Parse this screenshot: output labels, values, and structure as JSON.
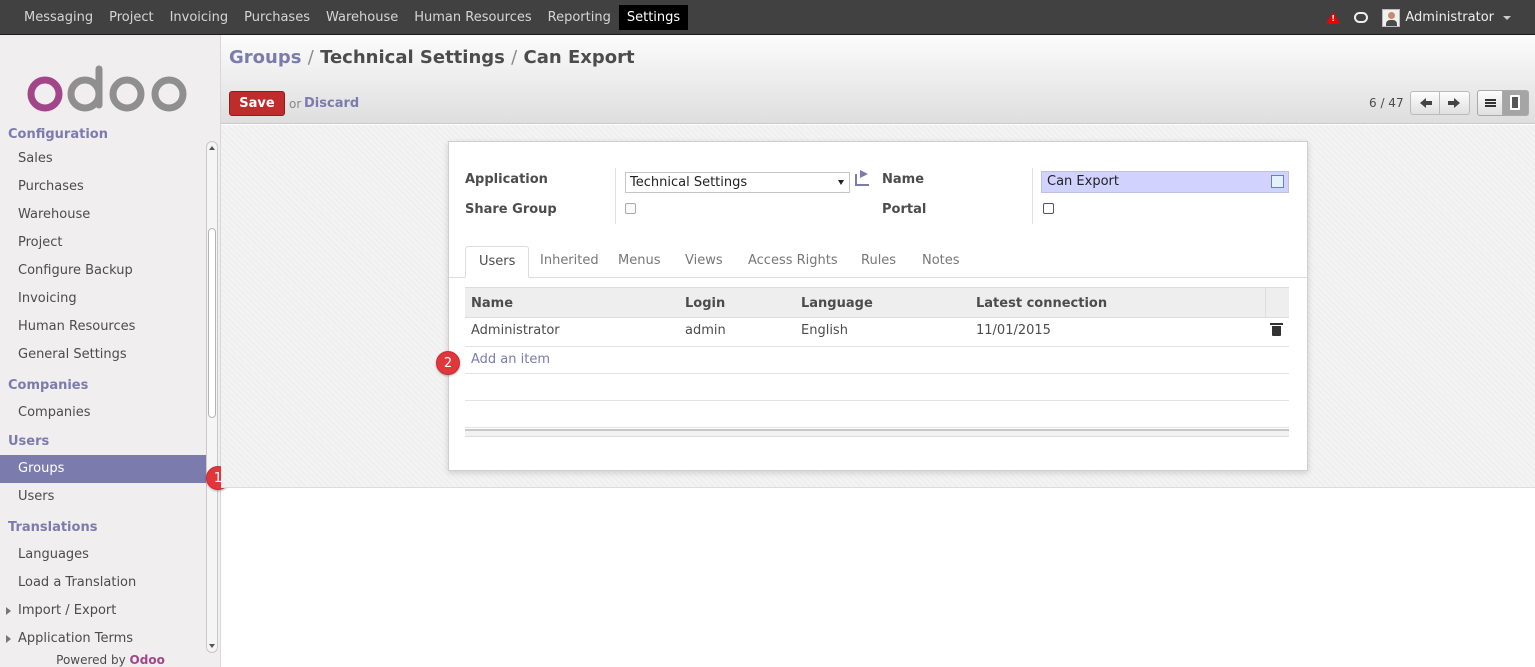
{
  "topbar": {
    "menu": [
      "Messaging",
      "Project",
      "Invoicing",
      "Purchases",
      "Warehouse",
      "Human Resources",
      "Reporting",
      "Settings"
    ],
    "active": "Settings",
    "user": "Administrator",
    "icons": [
      "warning-icon",
      "chat-icon",
      "avatar",
      "caret-down-icon"
    ]
  },
  "sidebar": {
    "logo": "odoo",
    "sections": [
      {
        "title": "Configuration",
        "items": [
          "Sales",
          "Purchases",
          "Warehouse",
          "Project",
          "Configure Backup",
          "Invoicing",
          "Human Resources",
          "General Settings"
        ]
      },
      {
        "title": "Companies",
        "items": [
          "Companies"
        ]
      },
      {
        "title": "Users",
        "items": [
          "Groups",
          "Users"
        ]
      },
      {
        "title": "Translations",
        "items": [
          "Languages",
          "Load a Translation",
          "Import / Export",
          "Application Terms"
        ]
      }
    ],
    "active_item": "Groups",
    "powered_prefix": "Powered by",
    "powered_brand": "Odoo"
  },
  "header": {
    "breadcrumb": {
      "link": "Groups",
      "sep1": "/",
      "middle": "Technical Settings",
      "sep2": "/",
      "current": "Can Export"
    },
    "save_label": "Save",
    "or_label": "or",
    "discard_label": "Discard",
    "pager": "6 / 47"
  },
  "form": {
    "application_label": "Application",
    "application_value": "Technical Settings",
    "share_group_label": "Share Group",
    "name_label": "Name",
    "name_value": "Can Export",
    "portal_label": "Portal"
  },
  "tabs": [
    "Users",
    "Inherited",
    "Menus",
    "Views",
    "Access Rights",
    "Rules",
    "Notes"
  ],
  "active_tab": "Users",
  "table": {
    "columns": [
      "Name",
      "Login",
      "Language",
      "Latest connection"
    ],
    "rows": [
      {
        "name": "Administrator",
        "login": "admin",
        "language": "English",
        "latest": "11/01/2015"
      }
    ],
    "add_item_label": "Add an item"
  },
  "badges": [
    "1",
    "2"
  ],
  "colors": {
    "accent": "#7c7bad",
    "brand": "#a24689",
    "save": "#c02c2c",
    "badge": "#e0373d"
  }
}
